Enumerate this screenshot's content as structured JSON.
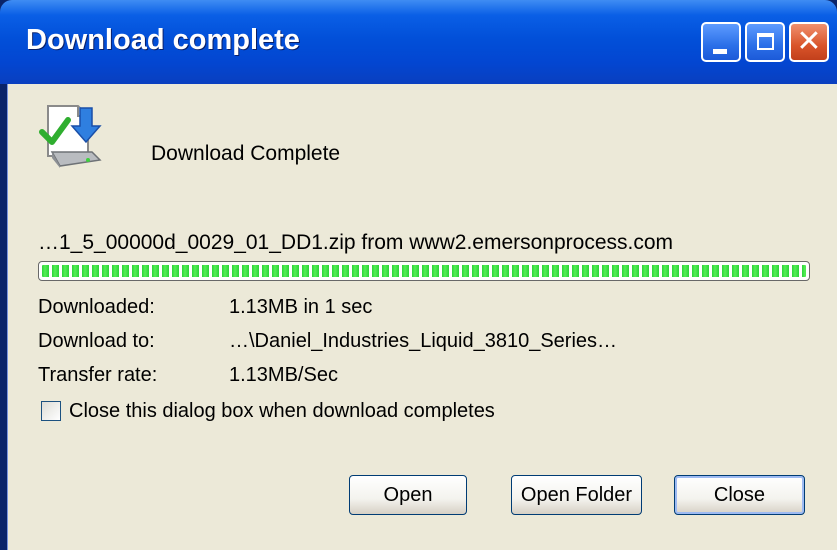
{
  "window": {
    "title": "Download complete",
    "controls": {
      "minimize_icon": "minimize-icon",
      "maximize_icon": "maximize-icon",
      "close_icon": "close-icon",
      "close_glyph": "✕"
    }
  },
  "heading": "Download Complete",
  "file": {
    "source": "…1_5_00000d_0029_01_DD1.zip from www2.emersonprocess.com"
  },
  "progress": {
    "fraction": 1.0
  },
  "details": {
    "downloaded_label": "Downloaded:",
    "downloaded_value": "1.13MB in 1 sec",
    "download_to_label": "Download to:",
    "download_to_value": "…\\Daniel_Industries_Liquid_3810_Series…",
    "transfer_rate_label": "Transfer rate:",
    "transfer_rate_value": "1.13MB/Sec"
  },
  "options": {
    "close_on_complete_label": "Close this dialog box when download completes",
    "close_on_complete_checked": false
  },
  "buttons": {
    "open": "Open",
    "open_folder": "Open Folder",
    "close": "Close"
  },
  "colors": {
    "titlebar": "#0250d9",
    "client": "#ece9d8",
    "progress_fill": "#2bd43a",
    "close_button": "#d9542a"
  }
}
